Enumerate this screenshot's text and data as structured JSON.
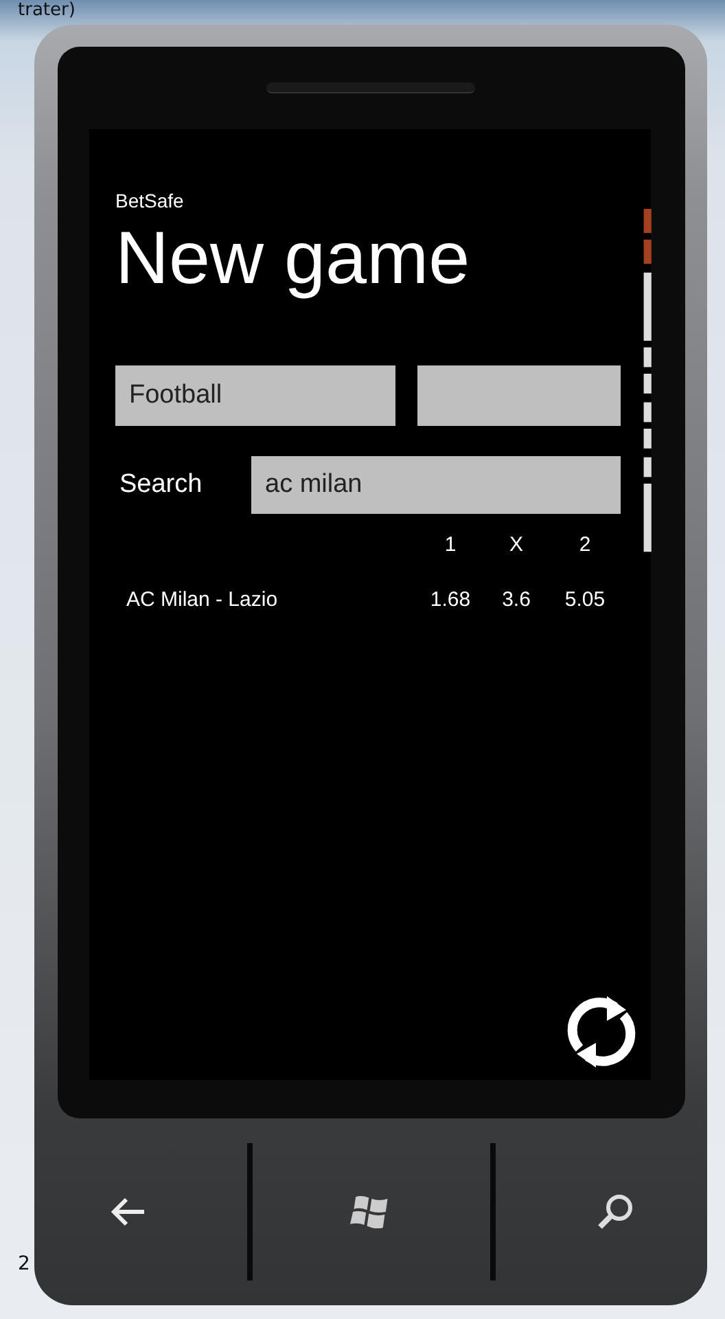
{
  "desktop": {
    "title_fragment": "trater)",
    "corner_text": "2"
  },
  "app_name": "BetSafe",
  "page_title": "New game",
  "sport_picker": {
    "value": "Football"
  },
  "search": {
    "label": "Search",
    "value": "ac milan"
  },
  "odds_table": {
    "columns": [
      "1",
      "X",
      "2"
    ],
    "rows": [
      {
        "match": "AC Milan - Lazio",
        "odds": [
          "1.68",
          "3.6",
          "5.05"
        ]
      }
    ]
  }
}
